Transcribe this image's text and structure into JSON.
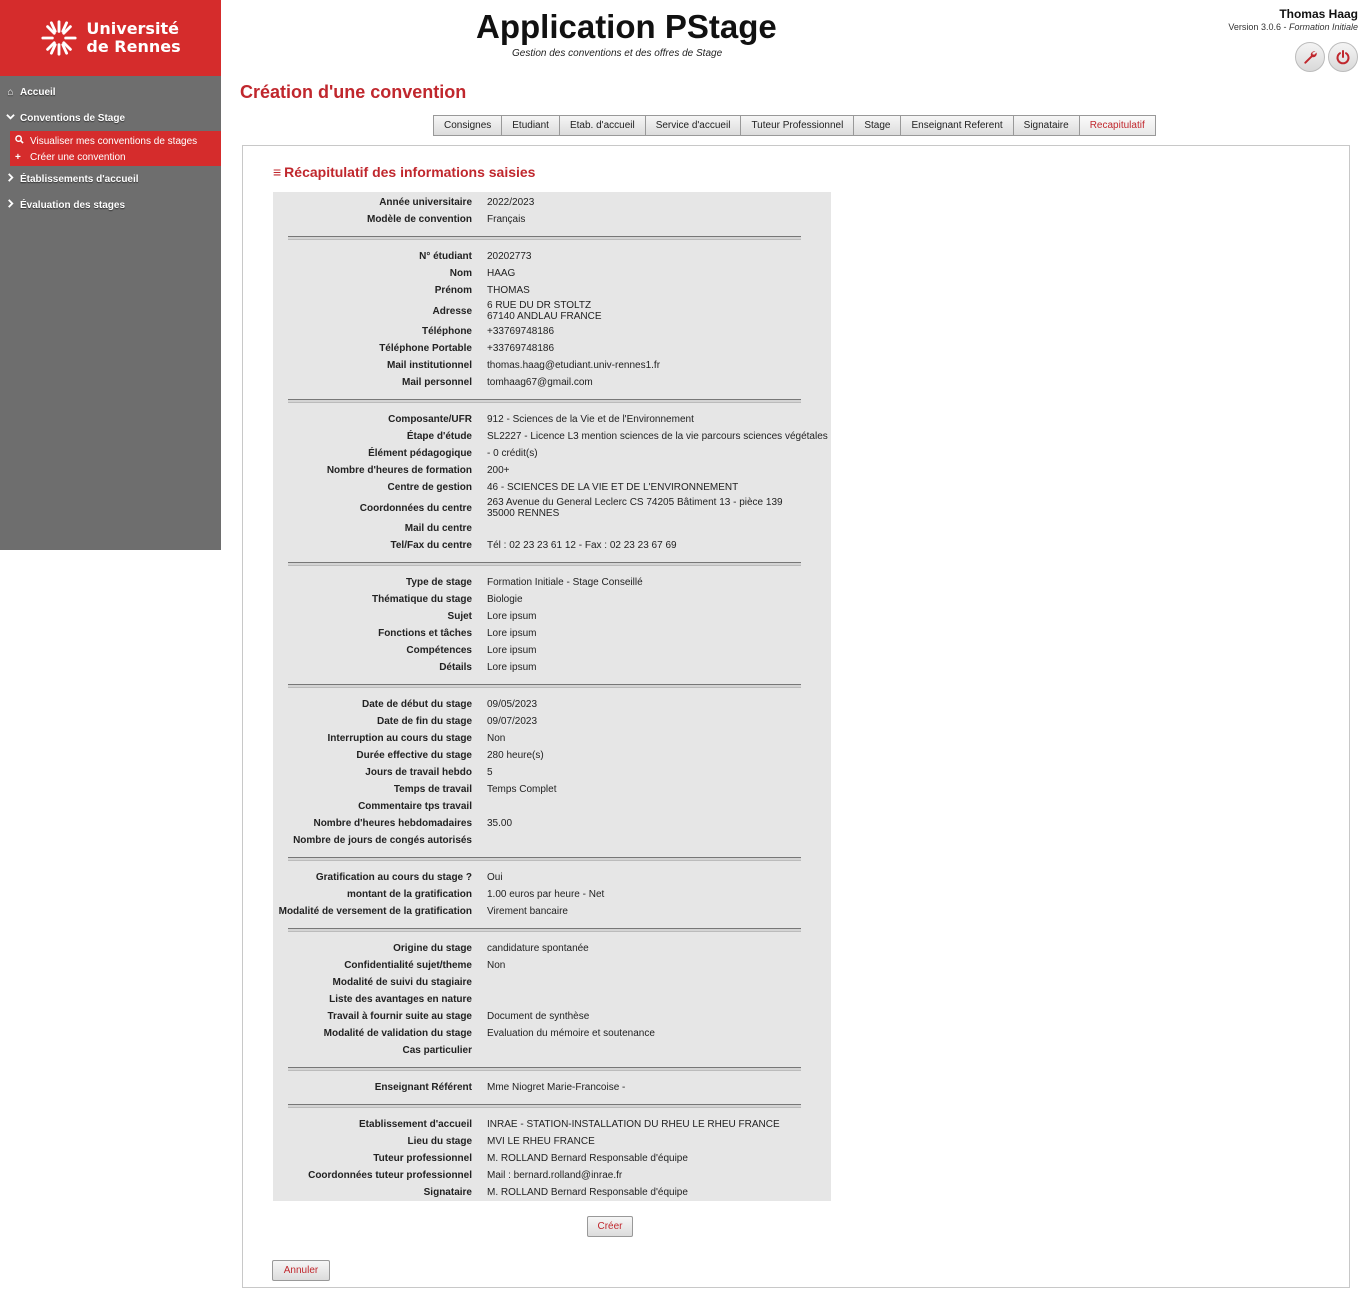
{
  "sidebar": {
    "logo_line1": "Université",
    "logo_line2": "de Rennes",
    "items": [
      {
        "label": "Accueil"
      },
      {
        "label": "Conventions de Stage"
      },
      {
        "label": "Établissements d'accueil"
      },
      {
        "label": "Évaluation des stages"
      }
    ],
    "subitems": [
      {
        "label": "Visualiser mes conventions de stages"
      },
      {
        "label": "Créer une convention"
      }
    ]
  },
  "header": {
    "title": "Application PStage",
    "subtitle": "Gestion des conventions et des offres de Stage",
    "user_name": "Thomas Haag",
    "version": "Version 3.0.6 - ",
    "profile": "Formation Initiale"
  },
  "page": {
    "title": "Création d'une convention",
    "section_title": "Récapitulatif des informations saisies"
  },
  "tabs": [
    {
      "label": "Consignes"
    },
    {
      "label": "Etudiant"
    },
    {
      "label": "Etab. d'accueil"
    },
    {
      "label": "Service d'accueil"
    },
    {
      "label": "Tuteur Professionnel"
    },
    {
      "label": "Stage"
    },
    {
      "label": "Enseignant Referent"
    },
    {
      "label": "Signataire"
    },
    {
      "label": "Recapitulatif"
    }
  ],
  "recap": [
    [
      {
        "label": "Année universitaire",
        "value": "2022/2023"
      },
      {
        "label": "Modèle de convention",
        "value": "Français"
      }
    ],
    [
      {
        "label": "N° étudiant",
        "value": "20202773"
      },
      {
        "label": "Nom",
        "value": "HAAG"
      },
      {
        "label": "Prénom",
        "value": "THOMAS"
      },
      {
        "label": "Adresse",
        "value": "6 RUE DU DR STOLTZ\n67140 ANDLAU FRANCE"
      },
      {
        "label": "Téléphone",
        "value": "+33769748186"
      },
      {
        "label": "Téléphone Portable",
        "value": "+33769748186"
      },
      {
        "label": "Mail institutionnel",
        "value": "thomas.haag@etudiant.univ-rennes1.fr"
      },
      {
        "label": "Mail personnel",
        "value": "tomhaag67@gmail.com"
      }
    ],
    [
      {
        "label": "Composante/UFR",
        "value": "912 - Sciences de la Vie et de l'Environnement"
      },
      {
        "label": "Étape d'étude",
        "value": "SL2227 - Licence L3 mention sciences de la vie parcours sciences végétales"
      },
      {
        "label": "Élément pédagogique",
        "value": "- 0 crédit(s)"
      },
      {
        "label": "Nombre d'heures de formation",
        "value": "200+"
      },
      {
        "label": "Centre de gestion",
        "value": "46 - SCIENCES DE LA VIE ET DE L'ENVIRONNEMENT"
      },
      {
        "label": "Coordonnées du centre",
        "value": "263 Avenue du General Leclerc CS 74205 Bâtiment 13 - pièce 139\n35000 RENNES"
      },
      {
        "label": "Mail du centre",
        "value": ""
      },
      {
        "label": "Tel/Fax du centre",
        "value": "Tél : 02 23 23 61 12 - Fax : 02 23 23 67 69"
      }
    ],
    [
      {
        "label": "Type de stage",
        "value": "Formation Initiale - Stage Conseillé"
      },
      {
        "label": "Thématique du stage",
        "value": "Biologie"
      },
      {
        "label": "Sujet",
        "value": "Lore ipsum"
      },
      {
        "label": "Fonctions et tâches",
        "value": "Lore ipsum"
      },
      {
        "label": "Compétences",
        "value": "Lore ipsum"
      },
      {
        "label": "Détails",
        "value": "Lore ipsum"
      }
    ],
    [
      {
        "label": "Date de début du stage",
        "value": "09/05/2023"
      },
      {
        "label": "Date de fin du stage",
        "value": "09/07/2023"
      },
      {
        "label": "Interruption au cours du stage",
        "value": "Non"
      },
      {
        "label": "Durée effective du stage",
        "value": "280 heure(s)"
      },
      {
        "label": "Jours de travail hebdo",
        "value": "5"
      },
      {
        "label": "Temps de travail",
        "value": "Temps Complet"
      },
      {
        "label": "Commentaire tps travail",
        "value": ""
      },
      {
        "label": "Nombre d'heures hebdomadaires",
        "value": "35.00"
      },
      {
        "label": "Nombre de jours de congés autorisés",
        "value": ""
      }
    ],
    [
      {
        "label": "Gratification au cours du stage ?",
        "value": "Oui"
      },
      {
        "label": "montant de la gratification",
        "value": "1.00 euros par heure - Net"
      },
      {
        "label": "Modalité de versement de la gratification",
        "value": "Virement bancaire"
      }
    ],
    [
      {
        "label": "Origine du stage",
        "value": "candidature spontanée"
      },
      {
        "label": "Confidentialité sujet/theme",
        "value": "Non"
      },
      {
        "label": "Modalité de suivi du stagiaire",
        "value": ""
      },
      {
        "label": "Liste des avantages en nature",
        "value": ""
      },
      {
        "label": "Travail à fournir suite au stage",
        "value": "Document de synthèse"
      },
      {
        "label": "Modalité de validation du stage",
        "value": "Evaluation du mémoire et soutenance"
      },
      {
        "label": "Cas particulier",
        "value": ""
      }
    ],
    [
      {
        "label": "Enseignant Référent",
        "value": "Mme Niogret Marie-Francoise -"
      }
    ],
    [
      {
        "label": "Etablissement d'accueil",
        "value": "INRAE - STATION-INSTALLATION DU RHEU LE RHEU FRANCE"
      },
      {
        "label": "Lieu du stage",
        "value": "MVI LE RHEU FRANCE"
      },
      {
        "label": "Tuteur professionnel",
        "value": "M. ROLLAND Bernard Responsable d'équipe"
      },
      {
        "label": "Coordonnées tuteur professionnel",
        "value": "Mail : bernard.rolland@inrae.fr"
      },
      {
        "label": "Signataire",
        "value": "M. ROLLAND Bernard Responsable d'équipe"
      }
    ]
  ],
  "buttons": {
    "create": "Créer",
    "cancel": "Annuler"
  },
  "colors": {
    "brand_red": "#d52c2c",
    "title_red": "#c0272d",
    "sidebar_gray": "#6e6e6e"
  }
}
